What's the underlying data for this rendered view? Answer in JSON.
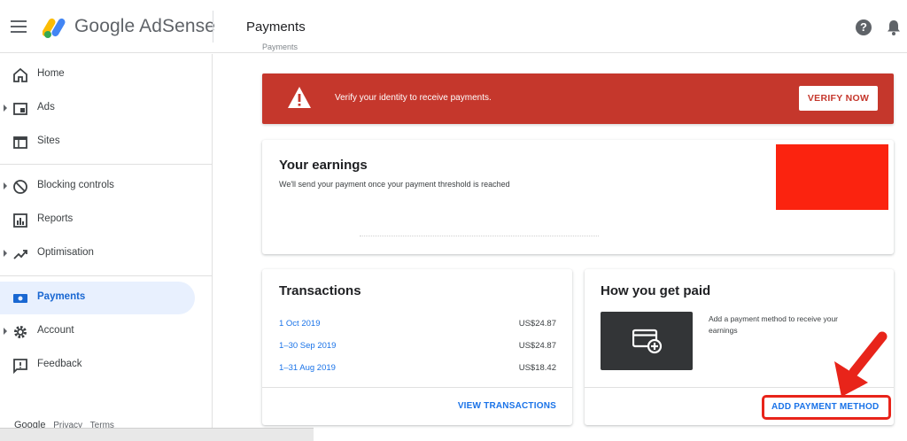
{
  "header": {
    "brand": "Google AdSense",
    "title": "Payments",
    "help_glyph": "?"
  },
  "sidebar": {
    "items": [
      {
        "label": "Home",
        "icon": "home-icon",
        "caret": false
      },
      {
        "label": "Ads",
        "icon": "ads-icon",
        "caret": true
      },
      {
        "label": "Sites",
        "icon": "sites-icon",
        "caret": false
      },
      {
        "label": "Blocking controls",
        "icon": "block-icon",
        "caret": true
      },
      {
        "label": "Reports",
        "icon": "reports-icon",
        "caret": false
      },
      {
        "label": "Optimisation",
        "icon": "trending-icon",
        "caret": true
      },
      {
        "label": "Payments",
        "icon": "payments-icon",
        "caret": false,
        "active": true
      },
      {
        "label": "Account",
        "icon": "gear-icon",
        "caret": true
      },
      {
        "label": "Feedback",
        "icon": "feedback-icon",
        "caret": false
      }
    ],
    "footer": {
      "google": "Google",
      "privacy": "Privacy",
      "terms": "Terms"
    }
  },
  "main": {
    "breadcrumb": "Payments",
    "alert": {
      "message": "Verify your identity to receive payments.",
      "button": "VERIFY NOW",
      "color": "#c5372c"
    },
    "earnings": {
      "title": "Your earnings",
      "subtitle": "We'll send your payment once your payment threshold is reached"
    },
    "transactions": {
      "title": "Transactions",
      "rows": [
        {
          "date": "1 Oct 2019",
          "amount": "US$24.87"
        },
        {
          "date": "1–30 Sep 2019",
          "amount": "US$24.87"
        },
        {
          "date": "1–31 Aug 2019",
          "amount": "US$18.42"
        }
      ],
      "view_link": "VIEW TRANSACTIONS"
    },
    "get_paid": {
      "title": "How you get paid",
      "description": "Add a payment method to receive your earnings",
      "add_link": "ADD PAYMENT METHOD"
    }
  },
  "colors": {
    "accent": "#1a73e8",
    "active_bg": "#e8f0fe",
    "annotation_red": "#e8241a"
  }
}
